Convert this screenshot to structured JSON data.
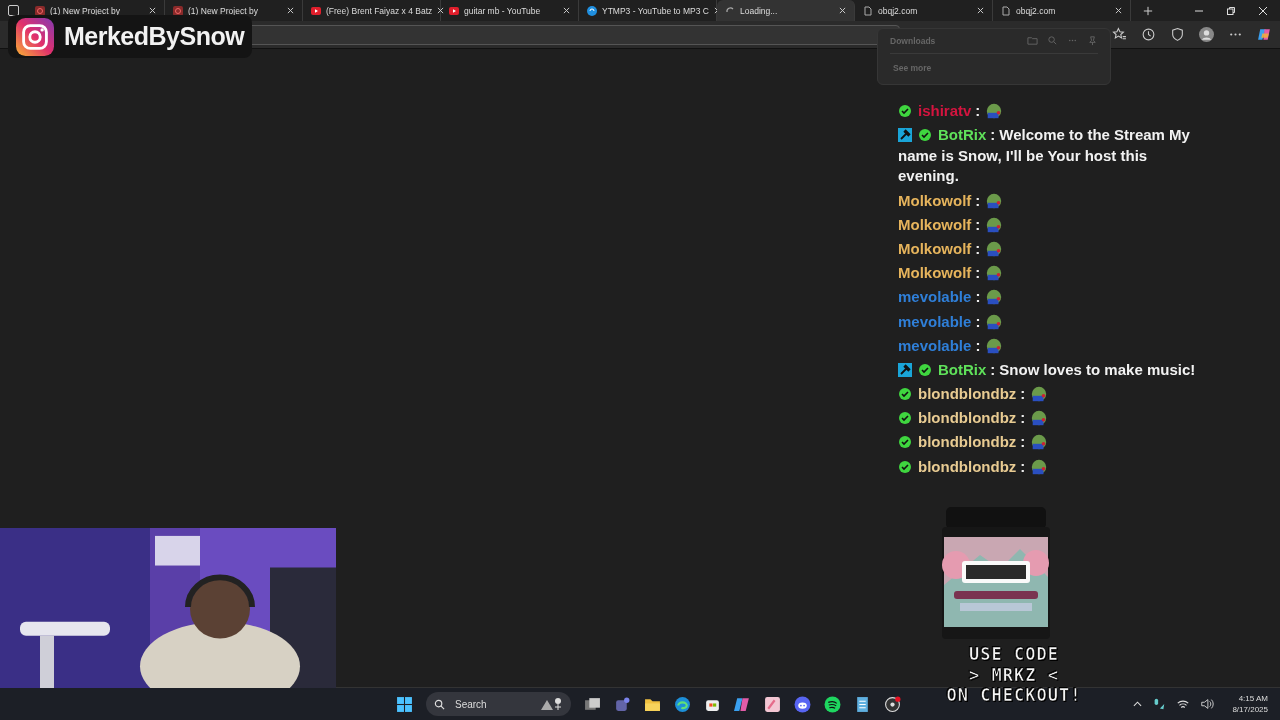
{
  "tabs": [
    {
      "label": "(1) New Project by",
      "kind": "page",
      "selected": false
    },
    {
      "label": "(1) New Project by",
      "kind": "page",
      "selected": false
    },
    {
      "label": "(Free) Brent Faiyaz x 4 Batz",
      "kind": "video",
      "selected": false
    },
    {
      "label": "guitar mb - YouTube",
      "kind": "video",
      "selected": false
    },
    {
      "label": "YTMP3 - YouTube to MP3 C",
      "kind": "globe",
      "selected": false
    },
    {
      "label": "Loading...",
      "kind": "loading",
      "selected": true
    },
    {
      "label": "obqj2.com",
      "kind": "file",
      "selected": false
    },
    {
      "label": "obqj2.com",
      "kind": "file",
      "selected": false
    }
  ],
  "overlay": {
    "handle": "MerkedBySnow"
  },
  "downloads": {
    "title": "Downloads",
    "link": "See more"
  },
  "chat": [
    {
      "user": "ishiratv",
      "color": "#d4143f",
      "moderator": false,
      "verified": true,
      "separator": ":",
      "emote": true
    },
    {
      "user": "BotRix",
      "color": "#5fe15a",
      "moderator": true,
      "verified": true,
      "separator": ":",
      "text": "Welcome to the Stream My name is Snow, I'll be Your host this evening."
    },
    {
      "user": "Molkowolf",
      "color": "#e6b45c",
      "moderator": false,
      "verified": false,
      "separator": ":",
      "emote": true
    },
    {
      "user": "Molkowolf",
      "color": "#e6b45c",
      "moderator": false,
      "verified": false,
      "separator": ":",
      "emote": true
    },
    {
      "user": "Molkowolf",
      "color": "#e6b45c",
      "moderator": false,
      "verified": false,
      "separator": ":",
      "emote": true
    },
    {
      "user": "Molkowolf",
      "color": "#e6b45c",
      "moderator": false,
      "verified": false,
      "separator": ":",
      "emote": true
    },
    {
      "user": "mevolable",
      "color": "#2f7fd8",
      "moderator": false,
      "verified": false,
      "separator": ":",
      "emote": true
    },
    {
      "user": "mevolable",
      "color": "#2f7fd8",
      "moderator": false,
      "verified": false,
      "separator": ":",
      "emote": true
    },
    {
      "user": "mevolable",
      "color": "#2f7fd8",
      "moderator": false,
      "verified": false,
      "separator": ":",
      "emote": true
    },
    {
      "user": "BotRix",
      "color": "#5fe15a",
      "moderator": true,
      "verified": true,
      "separator": ":",
      "text": "Snow loves to make music!"
    },
    {
      "user": "blondblondbz",
      "color": "#e8cb92",
      "moderator": false,
      "verified": true,
      "separator": ":",
      "emote": true
    },
    {
      "user": "blondblondbz",
      "color": "#e8cb92",
      "moderator": false,
      "verified": true,
      "separator": ":",
      "emote": true
    },
    {
      "user": "blondblondbz",
      "color": "#e8cb92",
      "moderator": false,
      "verified": true,
      "separator": ":",
      "emote": true
    },
    {
      "user": "blondblondbz",
      "color": "#e8cb92",
      "moderator": false,
      "verified": true,
      "separator": ":",
      "emote": true
    }
  ],
  "promo": [
    "USE CODE",
    "> MRKZ <",
    "ON CHECKOUT!"
  ],
  "taskbar": {
    "search": {
      "placeholder": "Search"
    },
    "time": "4:15 AM",
    "date": "8/17/2025"
  }
}
